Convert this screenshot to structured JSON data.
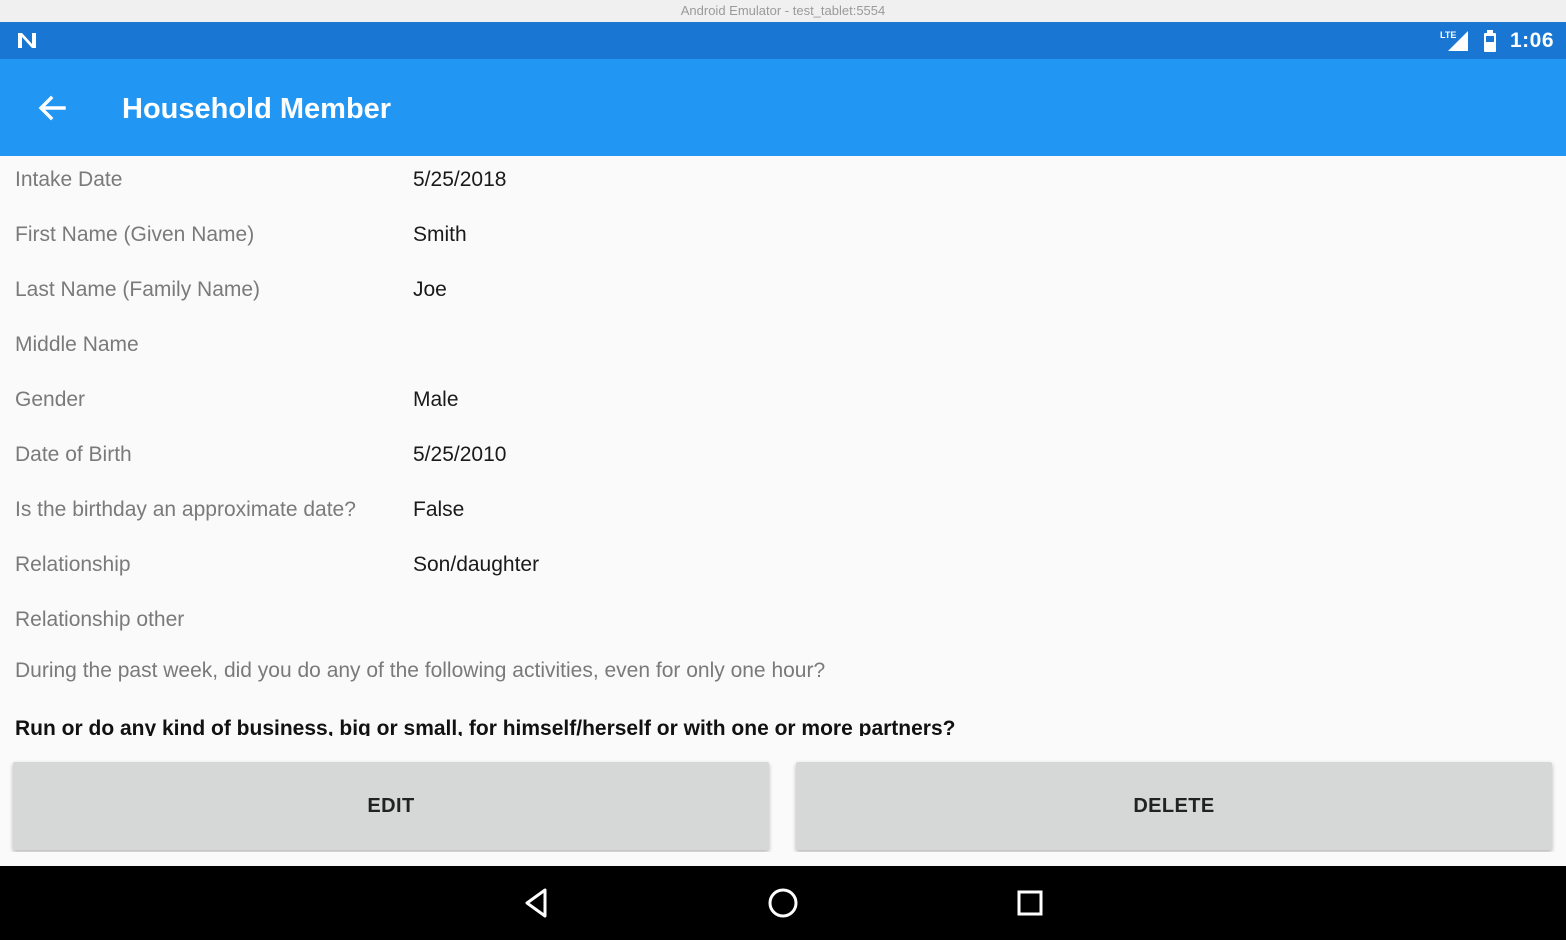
{
  "window": {
    "title": "Android Emulator - test_tablet:5554"
  },
  "status_bar": {
    "network": "LTE",
    "time": "1:06"
  },
  "app_bar": {
    "title": "Household Member",
    "back_icon": "arrow-back-icon"
  },
  "fields": [
    {
      "label": "Intake Date",
      "value": "5/25/2018"
    },
    {
      "label": "First Name (Given Name)",
      "value": "Smith"
    },
    {
      "label": "Last Name (Family Name)",
      "value": "Joe"
    },
    {
      "label": "Middle Name",
      "value": ""
    },
    {
      "label": "Gender",
      "value": "Male"
    },
    {
      "label": "Date of Birth",
      "value": "5/25/2010"
    },
    {
      "label": "Is the birthday an approximate date?",
      "value": "False"
    },
    {
      "label": "Relationship",
      "value": "Son/daughter"
    },
    {
      "label": "Relationship other",
      "value": ""
    }
  ],
  "question": "During the past week, did you do any of the following activities, even for only one hour?",
  "sub_question": "Run or do any kind of business, big or small, for himself/herself or with one or more partners?",
  "buttons": {
    "edit": "EDIT",
    "delete": "DELETE"
  },
  "nav_bar": {
    "back_icon": "nav-back-icon",
    "home_icon": "nav-home-icon",
    "recents_icon": "nav-recents-icon"
  },
  "colors": {
    "status_bar": "#1976d2",
    "app_bar": "#2196f3",
    "button": "#d6d7d7",
    "nav_bar": "#000000"
  }
}
